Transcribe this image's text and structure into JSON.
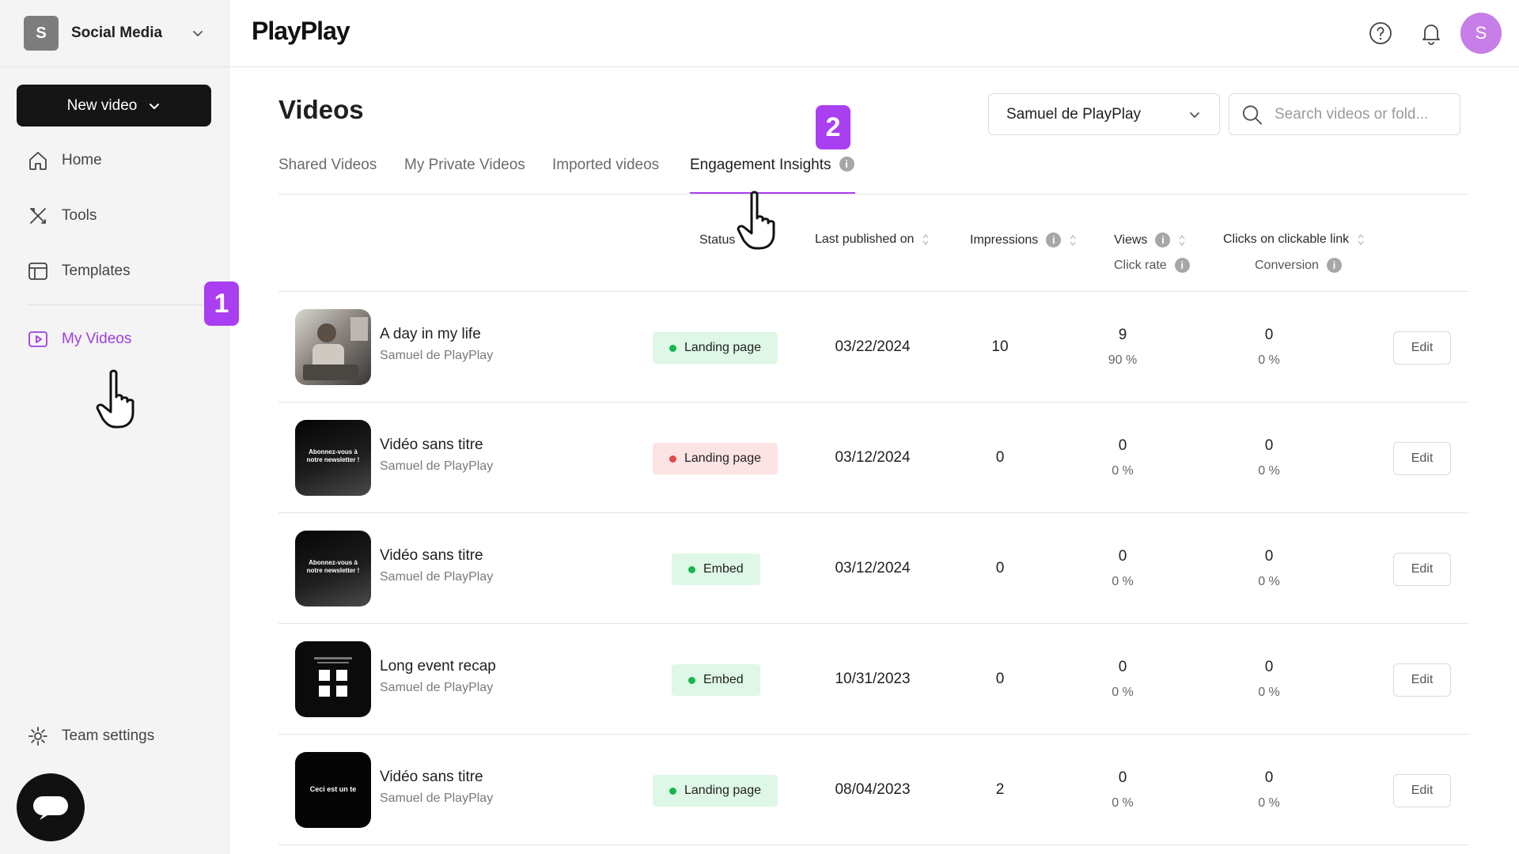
{
  "workspace": {
    "initial": "S",
    "name": "Social Media"
  },
  "sidebar": {
    "new_video_label": "New video",
    "items": [
      {
        "label": "Home",
        "icon": "home-icon"
      },
      {
        "label": "Tools",
        "icon": "tools-icon"
      },
      {
        "label": "Templates",
        "icon": "templates-icon"
      },
      {
        "label": "My Videos",
        "icon": "videos-icon",
        "active": true
      }
    ],
    "team_settings_label": "Team settings"
  },
  "annotations": {
    "step1": "1",
    "step2": "2"
  },
  "header": {
    "logo": "PlayPlay",
    "user_initial": "S"
  },
  "main": {
    "title": "Videos",
    "owner_filter": "Samuel de PlayPlay",
    "search_placeholder": "Search videos or fold...",
    "tabs": [
      {
        "label": "Shared Videos"
      },
      {
        "label": "My Private Videos"
      },
      {
        "label": "Imported videos"
      },
      {
        "label": "Engagement Insights",
        "active": true
      }
    ],
    "columns": {
      "status": "Status",
      "last_published": "Last published on",
      "impressions": "Impressions",
      "views": "Views",
      "click_rate": "Click rate",
      "clicks": "Clicks on clickable link",
      "conversion": "Conversion"
    },
    "rows": [
      {
        "title": "A day in my life",
        "owner": "Samuel de PlayPlay",
        "status": "Landing page",
        "status_type": "ok",
        "date": "03/22/2024",
        "impressions": "10",
        "views": "9",
        "click_rate": "90 %",
        "clicks": "0",
        "conversion": "0 %",
        "edit": "Edit",
        "thumb_text": ""
      },
      {
        "title": "Vidéo sans titre",
        "owner": "Samuel de PlayPlay",
        "status": "Landing page",
        "status_type": "bad",
        "date": "03/12/2024",
        "impressions": "0",
        "views": "0",
        "click_rate": "0 %",
        "clicks": "0",
        "conversion": "0 %",
        "edit": "Edit",
        "thumb_text": "Abonnez-vous à notre newsletter !"
      },
      {
        "title": "Vidéo sans titre",
        "owner": "Samuel de PlayPlay",
        "status": "Embed",
        "status_type": "ok",
        "date": "03/12/2024",
        "impressions": "0",
        "views": "0",
        "click_rate": "0 %",
        "clicks": "0",
        "conversion": "0 %",
        "edit": "Edit",
        "thumb_text": "Abonnez-vous à notre newsletter !"
      },
      {
        "title": "Long event recap",
        "owner": "Samuel de PlayPlay",
        "status": "Embed",
        "status_type": "ok",
        "date": "10/31/2023",
        "impressions": "0",
        "views": "0",
        "click_rate": "0 %",
        "clicks": "0",
        "conversion": "0 %",
        "edit": "Edit",
        "thumb_text": ""
      },
      {
        "title": "Vidéo sans titre",
        "owner": "Samuel de PlayPlay",
        "status": "Landing page",
        "status_type": "ok",
        "date": "08/04/2023",
        "impressions": "2",
        "views": "0",
        "click_rate": "0 %",
        "clicks": "0",
        "conversion": "0 %",
        "edit": "Edit",
        "thumb_text": "Ceci est un te"
      }
    ]
  },
  "colors": {
    "accent": "#a93ff0",
    "status_ok_bg": "#def7e6",
    "status_ok_dot": "#17b64e",
    "status_bad_bg": "#fde4e4",
    "status_bad_dot": "#e44848"
  }
}
